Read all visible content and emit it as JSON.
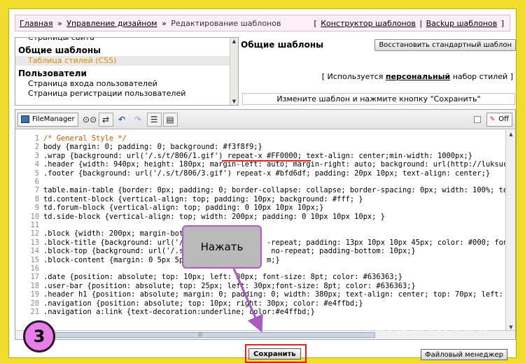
{
  "breadcrumb": {
    "home": "Главная",
    "sep": "»",
    "design": "Управление дизайном",
    "current": "Редактирование шаблонов"
  },
  "top_links": {
    "open": "[",
    "constructor": "Конструктор шаблонов",
    "divider": "|",
    "backup": "Backup шаблонов",
    "close": "]"
  },
  "tree": {
    "cut_item": "Страницы сайта",
    "groups": [
      {
        "title": "Общие шаблоны",
        "items": [
          "Таблица стилей (CSS)"
        ]
      },
      {
        "title": "Пользователи",
        "items": [
          "Страница входа пользователей",
          "Страница регистрации пользователей"
        ]
      }
    ]
  },
  "panel": {
    "title": "Общие шаблоны",
    "restore_label": "Восстановить стандартный шаблон",
    "note_prefix": "[ Используется ",
    "note_bold": "персональный",
    "note_suffix": " набор стилей ]",
    "hint": "Измените шаблон и нажмите кнопку \"Сохранить\""
  },
  "toolbar": {
    "filemanager": "FileManager",
    "off": "Off",
    "icons": [
      "binoculars-icon",
      "replace-icon",
      "undo-icon",
      "redo-icon",
      "line-numbers-icon",
      "highlight-icon"
    ]
  },
  "code_lines": [
    {
      "n": "1",
      "t": "/* General Style */"
    },
    {
      "n": "2",
      "t": "body {margin: 0; padding: 0; background: #f3f8f9;}"
    },
    {
      "n": "3",
      "t": ".wrap {background: url('/.s/t/806/1.gif') repeat-x #FF0000; text-align: center;min-width: 1000px;}"
    },
    {
      "n": "4",
      "t": ".header {width: 940px; height: 180px; margin-left: auto; margin-right: auto; background: url(http://luksuche"
    },
    {
      "n": "5",
      "t": ".footer {background: url('/.s/t/806/3.gif') repeat-x #bfd6df; padding: 20px 10px; text-align: center;}"
    },
    {
      "n": "6",
      "t": ""
    },
    {
      "n": "7",
      "t": "table.main-table {border: 0px; padding: 0; border-collapse: collapse; border-spacing: 0px; width: 100%; tex"
    },
    {
      "n": "8",
      "t": "td.content-block {vertical-align: top; padding: 10px; background: #fff; }"
    },
    {
      "n": "9",
      "t": "td.forum-block {vertical-align: top; padding: 0 10px 10px 10px;}"
    },
    {
      "n": "10",
      "t": "td.side-block {vertical-align: top; width: 200px; padding: 0 10px 10px 10px; }"
    },
    {
      "n": "11",
      "t": ""
    },
    {
      "n": "12",
      "t": ".block {width: 200px; margin-bott"
    },
    {
      "n": "13",
      "t": ".block-title {background: url('/                   -repeat; padding: 13px 10px 10px 45px; color: #000; font-"
    },
    {
      "n": "14",
      "t": ".block-top {background: url('/.s                    no-repeat; padding-bottom: 10px;}"
    },
    {
      "n": "15",
      "t": ".block-content {margin: 0 5px 5p                   m;}"
    },
    {
      "n": "16",
      "t": ""
    },
    {
      "n": "17",
      "t": ".date {position: absolute; top: 10px; left: 30px; font-size: 8pt; color: #636363;}"
    },
    {
      "n": "18",
      "t": ".user-bar {position: absolute; top: 25px; left: 30px;font-size: 8pt; color: #636363;}"
    },
    {
      "n": "19",
      "t": ".header h1 {position: absolute; margin: 0; padding: 0; width: 380px; text-align: center; top: 70px; left: 30"
    },
    {
      "n": "20",
      "t": ".navigation {position: absolute; top: 10px; right: 30px; color: #e4ffbd;}"
    },
    {
      "n": "21",
      "t": ".navigation a:link {text-decoration:underline; color:#e4ffbd;}"
    }
  ],
  "buttons": {
    "save": "Сохранить",
    "filemanager": "Файловый менеджер"
  },
  "callout": {
    "text": "Нажать"
  },
  "step_badge": {
    "text": "3"
  },
  "watermark": {
    "text": "luksucheba"
  },
  "colors": {
    "background": "#f0dc2c",
    "highlight": "#e02020",
    "callout_border": "#b05ac8",
    "badge": "#e87ee8"
  }
}
